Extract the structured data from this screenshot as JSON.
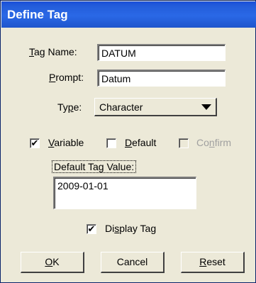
{
  "dialog": {
    "title": "Define Tag"
  },
  "fields": {
    "tag_name": {
      "label_underline": "T",
      "label_rest": "ag Name:",
      "value": "DATUM"
    },
    "prompt": {
      "label_underline": "P",
      "label_rest": "rompt:",
      "value": "Datum"
    },
    "type": {
      "label_pre": "Ty",
      "label_underline": "p",
      "label_post": "e:",
      "value": "Character"
    }
  },
  "checkboxes": {
    "variable": {
      "label_underline": "V",
      "label_rest": "ariable",
      "checked": true,
      "mark": "✔"
    },
    "default": {
      "label_underline": "D",
      "label_rest": "efault",
      "checked": false,
      "mark": ""
    },
    "confirm": {
      "label_pre": "Co",
      "label_underline": "n",
      "label_post": "firm",
      "checked": false,
      "disabled": true,
      "mark": ""
    }
  },
  "default_value": {
    "label": "Default Tag Value:",
    "value": "2009-01-01"
  },
  "display_tag": {
    "label_pre": "Di",
    "label_underline": "s",
    "label_post": "play Tag",
    "checked": true,
    "mark": "✔"
  },
  "buttons": {
    "ok": {
      "label_underline": "O",
      "label_rest": "K"
    },
    "cancel": {
      "label": "Cancel"
    },
    "reset": {
      "label_underline": "R",
      "label_rest": "eset"
    }
  },
  "colors": {
    "titlebar": "#245edb",
    "face": "#ece9d8",
    "disabled_text": "#a0a0a0"
  }
}
